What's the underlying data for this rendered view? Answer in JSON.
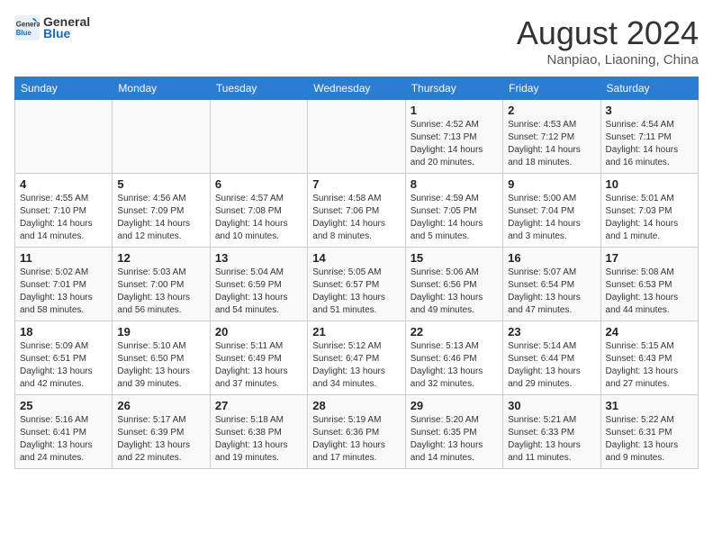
{
  "header": {
    "logo_line1": "General",
    "logo_line2": "Blue",
    "month": "August 2024",
    "location": "Nanpiao, Liaoning, China"
  },
  "weekdays": [
    "Sunday",
    "Monday",
    "Tuesday",
    "Wednesday",
    "Thursday",
    "Friday",
    "Saturday"
  ],
  "weeks": [
    [
      {
        "day": "",
        "info": ""
      },
      {
        "day": "",
        "info": ""
      },
      {
        "day": "",
        "info": ""
      },
      {
        "day": "",
        "info": ""
      },
      {
        "day": "1",
        "info": "Sunrise: 4:52 AM\nSunset: 7:13 PM\nDaylight: 14 hours\nand 20 minutes."
      },
      {
        "day": "2",
        "info": "Sunrise: 4:53 AM\nSunset: 7:12 PM\nDaylight: 14 hours\nand 18 minutes."
      },
      {
        "day": "3",
        "info": "Sunrise: 4:54 AM\nSunset: 7:11 PM\nDaylight: 14 hours\nand 16 minutes."
      }
    ],
    [
      {
        "day": "4",
        "info": "Sunrise: 4:55 AM\nSunset: 7:10 PM\nDaylight: 14 hours\nand 14 minutes."
      },
      {
        "day": "5",
        "info": "Sunrise: 4:56 AM\nSunset: 7:09 PM\nDaylight: 14 hours\nand 12 minutes."
      },
      {
        "day": "6",
        "info": "Sunrise: 4:57 AM\nSunset: 7:08 PM\nDaylight: 14 hours\nand 10 minutes."
      },
      {
        "day": "7",
        "info": "Sunrise: 4:58 AM\nSunset: 7:06 PM\nDaylight: 14 hours\nand 8 minutes."
      },
      {
        "day": "8",
        "info": "Sunrise: 4:59 AM\nSunset: 7:05 PM\nDaylight: 14 hours\nand 5 minutes."
      },
      {
        "day": "9",
        "info": "Sunrise: 5:00 AM\nSunset: 7:04 PM\nDaylight: 14 hours\nand 3 minutes."
      },
      {
        "day": "10",
        "info": "Sunrise: 5:01 AM\nSunset: 7:03 PM\nDaylight: 14 hours\nand 1 minute."
      }
    ],
    [
      {
        "day": "11",
        "info": "Sunrise: 5:02 AM\nSunset: 7:01 PM\nDaylight: 13 hours\nand 58 minutes."
      },
      {
        "day": "12",
        "info": "Sunrise: 5:03 AM\nSunset: 7:00 PM\nDaylight: 13 hours\nand 56 minutes."
      },
      {
        "day": "13",
        "info": "Sunrise: 5:04 AM\nSunset: 6:59 PM\nDaylight: 13 hours\nand 54 minutes."
      },
      {
        "day": "14",
        "info": "Sunrise: 5:05 AM\nSunset: 6:57 PM\nDaylight: 13 hours\nand 51 minutes."
      },
      {
        "day": "15",
        "info": "Sunrise: 5:06 AM\nSunset: 6:56 PM\nDaylight: 13 hours\nand 49 minutes."
      },
      {
        "day": "16",
        "info": "Sunrise: 5:07 AM\nSunset: 6:54 PM\nDaylight: 13 hours\nand 47 minutes."
      },
      {
        "day": "17",
        "info": "Sunrise: 5:08 AM\nSunset: 6:53 PM\nDaylight: 13 hours\nand 44 minutes."
      }
    ],
    [
      {
        "day": "18",
        "info": "Sunrise: 5:09 AM\nSunset: 6:51 PM\nDaylight: 13 hours\nand 42 minutes."
      },
      {
        "day": "19",
        "info": "Sunrise: 5:10 AM\nSunset: 6:50 PM\nDaylight: 13 hours\nand 39 minutes."
      },
      {
        "day": "20",
        "info": "Sunrise: 5:11 AM\nSunset: 6:49 PM\nDaylight: 13 hours\nand 37 minutes."
      },
      {
        "day": "21",
        "info": "Sunrise: 5:12 AM\nSunset: 6:47 PM\nDaylight: 13 hours\nand 34 minutes."
      },
      {
        "day": "22",
        "info": "Sunrise: 5:13 AM\nSunset: 6:46 PM\nDaylight: 13 hours\nand 32 minutes."
      },
      {
        "day": "23",
        "info": "Sunrise: 5:14 AM\nSunset: 6:44 PM\nDaylight: 13 hours\nand 29 minutes."
      },
      {
        "day": "24",
        "info": "Sunrise: 5:15 AM\nSunset: 6:43 PM\nDaylight: 13 hours\nand 27 minutes."
      }
    ],
    [
      {
        "day": "25",
        "info": "Sunrise: 5:16 AM\nSunset: 6:41 PM\nDaylight: 13 hours\nand 24 minutes."
      },
      {
        "day": "26",
        "info": "Sunrise: 5:17 AM\nSunset: 6:39 PM\nDaylight: 13 hours\nand 22 minutes."
      },
      {
        "day": "27",
        "info": "Sunrise: 5:18 AM\nSunset: 6:38 PM\nDaylight: 13 hours\nand 19 minutes."
      },
      {
        "day": "28",
        "info": "Sunrise: 5:19 AM\nSunset: 6:36 PM\nDaylight: 13 hours\nand 17 minutes."
      },
      {
        "day": "29",
        "info": "Sunrise: 5:20 AM\nSunset: 6:35 PM\nDaylight: 13 hours\nand 14 minutes."
      },
      {
        "day": "30",
        "info": "Sunrise: 5:21 AM\nSunset: 6:33 PM\nDaylight: 13 hours\nand 11 minutes."
      },
      {
        "day": "31",
        "info": "Sunrise: 5:22 AM\nSunset: 6:31 PM\nDaylight: 13 hours\nand 9 minutes."
      }
    ]
  ]
}
